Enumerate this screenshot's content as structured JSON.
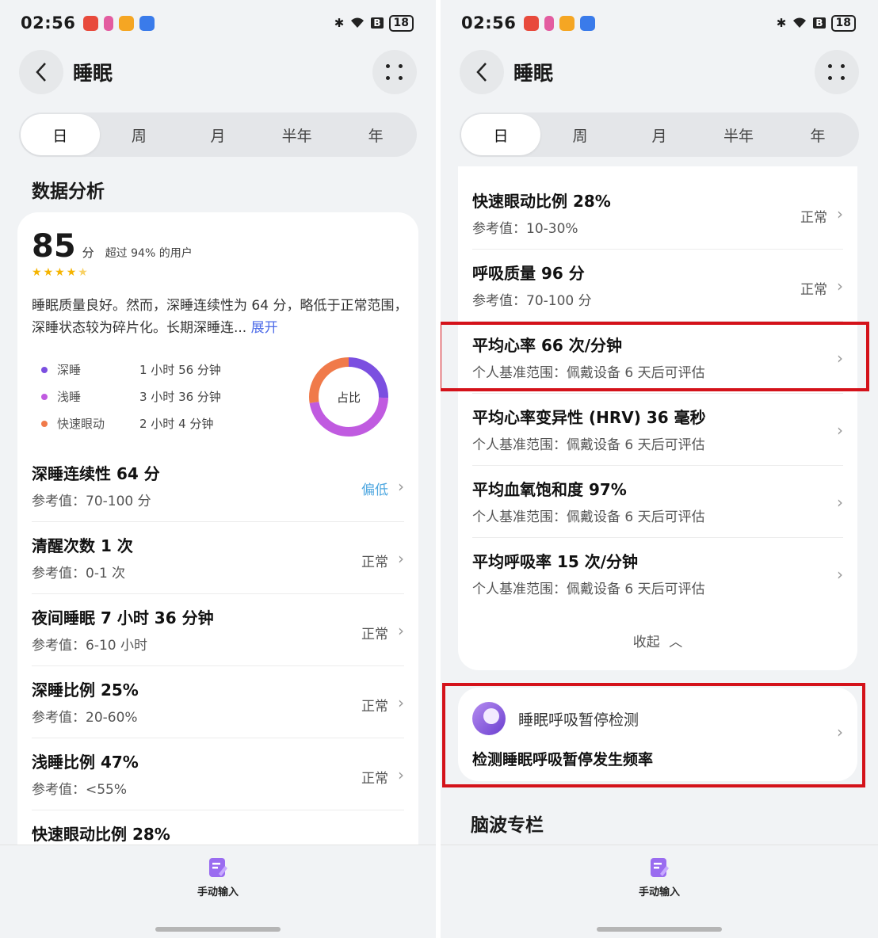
{
  "status": {
    "time": "02:56",
    "battery": "18"
  },
  "header": {
    "title": "睡眠"
  },
  "tabs": [
    "日",
    "周",
    "月",
    "半年",
    "年"
  ],
  "left": {
    "section_title": "数据分析",
    "score": "85",
    "score_unit": "分",
    "score_note": "超过 94% 的用户",
    "rating": {
      "value": 4.5,
      "max": 5
    },
    "summary": "睡眠质量良好。然而，深睡连续性为 64 分，略低于正常范围，深睡状态较为碎片化。长期深睡连...",
    "expand_label": "展开",
    "legend": [
      {
        "name": "深睡",
        "value": "1 小时 56 分钟",
        "color": "#7b4fe0"
      },
      {
        "name": "浅睡",
        "value": "3 小时 36 分钟",
        "color": "#c05be0"
      },
      {
        "name": "快速眼动",
        "value": "2 小时 4 分钟",
        "color": "#f07a4a"
      }
    ],
    "donut_label": "占比",
    "rows": [
      {
        "title": "深睡连续性 64 分",
        "ref": "参考值：70-100 分",
        "status": "偏低"
      },
      {
        "title": "清醒次数 1 次",
        "ref": "参考值：0-1 次",
        "status": "正常"
      },
      {
        "title": "夜间睡眠 7 小时 36 分钟",
        "ref": "参考值：6-10 小时",
        "status": "正常"
      },
      {
        "title": "深睡比例 25%",
        "ref": "参考值：20-60%",
        "status": "正常"
      },
      {
        "title": "浅睡比例 47%",
        "ref": "参考值：<55%",
        "status": "正常"
      },
      {
        "title": "快速眼动比例 28%",
        "ref": "",
        "status": ""
      }
    ]
  },
  "right": {
    "rows": [
      {
        "title": "快速眼动比例 28%",
        "ref": "参考值：10-30%",
        "status": "正常"
      },
      {
        "title": "呼吸质量 96 分",
        "ref": "参考值：70-100 分",
        "status": "正常"
      },
      {
        "title": "平均心率 66 次/分钟",
        "ref": "个人基准范围：佩戴设备 6 天后可评估",
        "status": ""
      },
      {
        "title": "平均心率变异性 (HRV) 36 毫秒",
        "ref": "个人基准范围：佩戴设备 6 天后可评估",
        "status": ""
      },
      {
        "title": "平均血氧饱和度 97%",
        "ref": "个人基准范围：佩戴设备 6 天后可评估",
        "status": ""
      },
      {
        "title": "平均呼吸率 15 次/分钟",
        "ref": "个人基准范围：佩戴设备 6 天后可评估",
        "status": ""
      }
    ],
    "collapse_label": "收起",
    "apnea": {
      "title": "睡眠呼吸暂停检测",
      "subtitle": "检测睡眠呼吸暂停发生频率"
    },
    "section_title": "脑波专栏"
  },
  "bottom": {
    "manual_label": "手动输入"
  },
  "icons": {
    "back": "chevron-left-icon",
    "more": "more-dots-icon",
    "chevron": "chevron-right-icon",
    "manual": "edit-note-icon"
  }
}
